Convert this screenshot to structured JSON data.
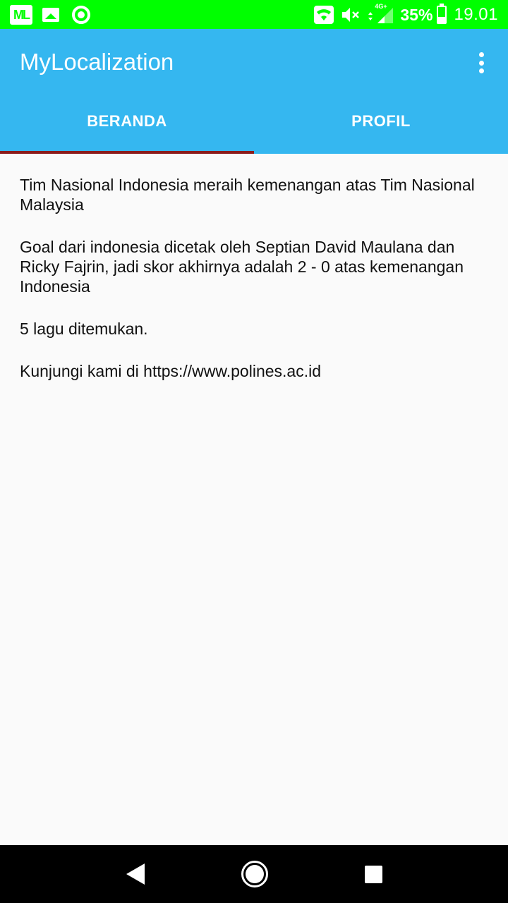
{
  "status_bar": {
    "left_icons": [
      "ml-app-icon",
      "image-icon",
      "circle-icon"
    ],
    "right_icons": [
      "wifi-icon",
      "mute-icon",
      "network-4g-icon",
      "battery-icon"
    ],
    "network_label": "4G+",
    "battery_percent": "35%",
    "battery_level": 0.35,
    "time": "19.01",
    "background_color": "#00ff00"
  },
  "app_bar": {
    "title": "MyLocalization",
    "background_color": "#35b7f0",
    "overflow_icon": "more-vert-icon"
  },
  "tabs": [
    {
      "label": "BERANDA",
      "active": true
    },
    {
      "label": "PROFIL",
      "active": false
    }
  ],
  "tab_indicator_color": "#8b1c1c",
  "content": {
    "paragraphs": [
      "Tim Nasional Indonesia meraih kemenangan atas Tim Nasional Malaysia",
      "Goal dari indonesia dicetak oleh Septian David Maulana dan Ricky Fajrin, jadi skor akhirnya adalah 2 - 0 atas kemenangan Indonesia",
      "5 lagu ditemukan.",
      "Kunjungi kami di https://www.polines.ac.id"
    ]
  },
  "nav_bar": {
    "buttons": [
      "back-icon",
      "home-icon",
      "recents-icon"
    ]
  }
}
